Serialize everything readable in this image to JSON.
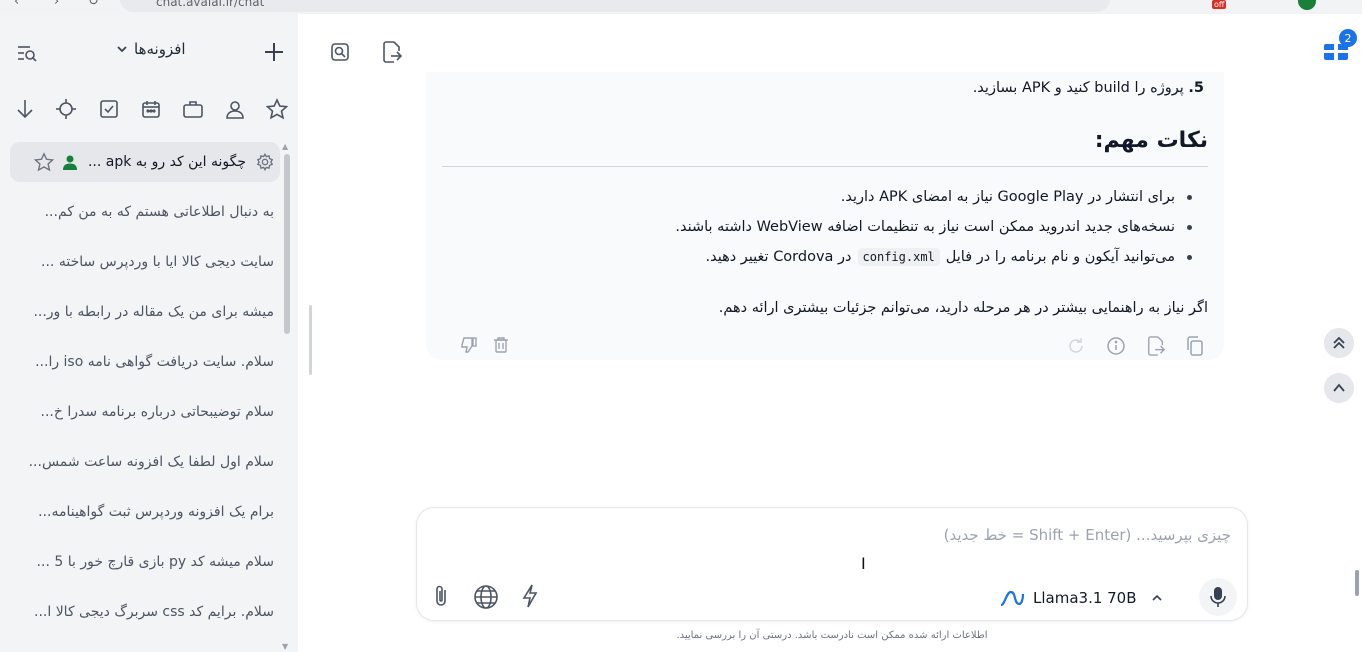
{
  "browser": {
    "url": "chat.avalai.ir/chat",
    "badge": "off"
  },
  "sidebar": {
    "title": "افزونه‌ها",
    "chats": [
      {
        "label": "چگونه این کد رو به apk ...",
        "active": true
      },
      {
        "label": "به دنبال اطلاعاتی هستم که به من کم..."
      },
      {
        "label": "سایت دیجی کالا ایا با وردپرس ساخته ..."
      },
      {
        "label": "میشه برای من یک مقاله در رابطه با ور..."
      },
      {
        "label": "سلام. سایت دریافت گواهی نامه iso را..."
      },
      {
        "label": "سلام توضیبحاتی درباره برنامه سدرا خ..."
      },
      {
        "label": "سلام اول لطفا یک افزونه ساعت شمس..."
      },
      {
        "label": "برام یک افزونه وردپرس ثبت گواهینامه..."
      },
      {
        "label": "سلام میشه کد py بازی قارچ خور با 5 ..."
      },
      {
        "label": "سلام. برایم کد css سربرگ دیجی کالا ا..."
      }
    ]
  },
  "message": {
    "step_number": "5.",
    "step_text": "پروژه را build کنید و APK بسازید.",
    "notes_heading": "نکات مهم:",
    "bullet1": "برای انتشار در Google Play نیاز به امضای APK دارید.",
    "bullet2": "نسخه‌های جدید اندروید ممکن است نیاز به تنظیمات اضافه WebView داشته باشند.",
    "bullet3_before": "می‌توانید آیکون و نام برنامه را در فایل",
    "bullet3_code": "config.xml",
    "bullet3_after": "در Cordova تغییر دهید.",
    "closing": "اگر نیاز به راهنمایی بیشتر در هر مرحله دارید، می‌توانم جزئیات بیشتری ارائه دهم."
  },
  "extension": {
    "badge_count": "2"
  },
  "composer": {
    "placeholder": "چیزی بپرسید... (Shift + Enter = خط جدید)",
    "model": "Llama3.1 70B"
  },
  "disclaimer": "اطلاعات ارائه شده ممکن است نادرست باشد. درستی آن را بررسی نمایید.",
  "colors": {
    "model_logo": "#1a73e8",
    "accent": "#1a73e8",
    "active_user_icon": "#15803d"
  }
}
